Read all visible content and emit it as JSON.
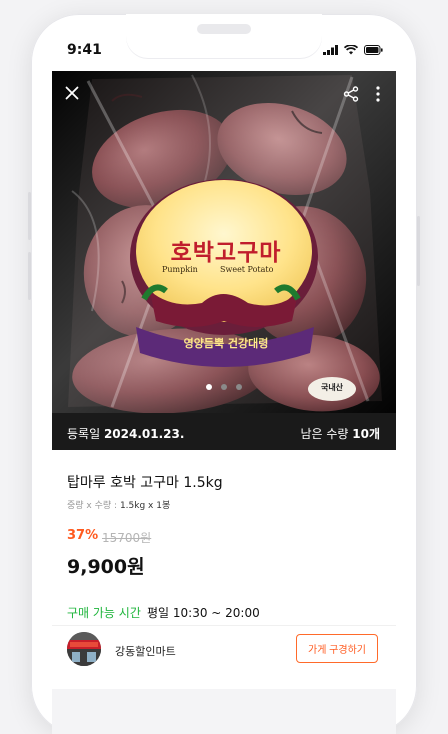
{
  "status_bar": {
    "time": "9:41"
  },
  "gallery": {
    "slide_count": 3,
    "active_slide": 1
  },
  "package_label": {
    "name": "호박고구마",
    "sub_left": "Pumpkin",
    "sub_right": "Sweet Potato",
    "ribbon": "영양듬뿍 건강대령",
    "origin": "국내산"
  },
  "info_bar": {
    "registered_label": "등록일",
    "registered_date": "2024.01.23.",
    "remaining_label": "남은 수량",
    "remaining_value": "10개"
  },
  "product": {
    "title": "탑마루 호박 고구마 1.5kg",
    "spec_label": "중량 x 수량 :",
    "spec_value": "1.5kg x 1봉",
    "discount": "37%",
    "original_price": "15700원",
    "price": "9,900원",
    "hours_label": "구매 가능 시간",
    "hours_value": "평일 10:30 ~ 20:00"
  },
  "store": {
    "name": "강동할인마트",
    "button_label": "가게 구경하기"
  }
}
